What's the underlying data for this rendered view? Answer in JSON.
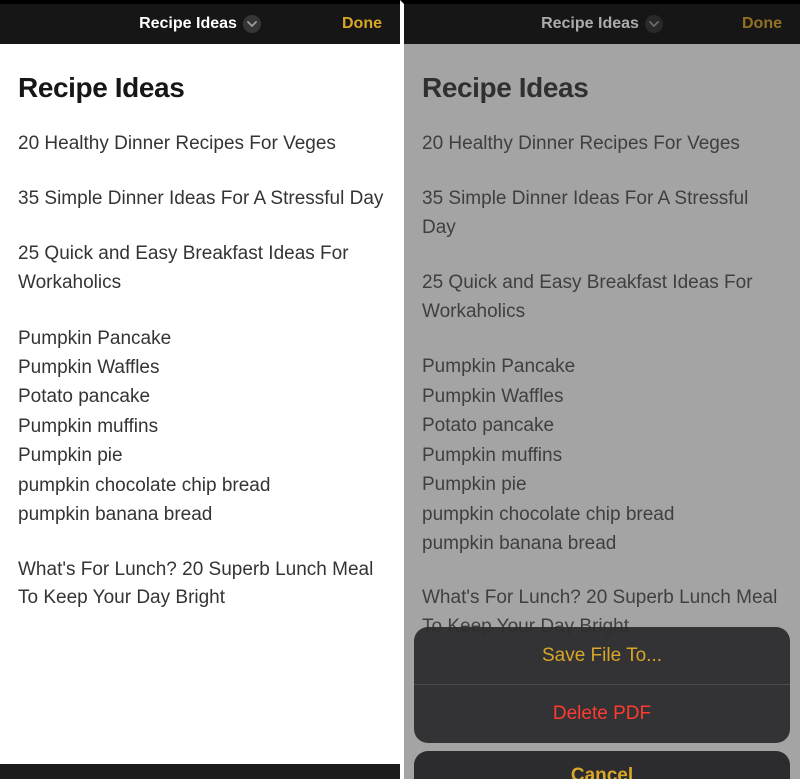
{
  "nav": {
    "title": "Recipe Ideas",
    "done": "Done"
  },
  "note": {
    "heading": "Recipe Ideas",
    "paragraphs": [
      "20 Healthy Dinner Recipes For Veges",
      "35 Simple Dinner Ideas For A Stressful Day",
      "25 Quick and Easy Breakfast Ideas For Workaholics"
    ],
    "list": [
      "Pumpkin Pancake",
      "Pumpkin Waffles",
      "Potato pancake",
      "Pumpkin muffins",
      "Pumpkin pie",
      "pumpkin chocolate chip bread",
      "pumpkin banana bread"
    ],
    "trailing": "What's For Lunch? 20 Superb Lunch Meal To Keep Your Day Bright"
  },
  "sheet": {
    "save": "Save File To...",
    "delete": "Delete PDF",
    "cancel": "Cancel"
  }
}
